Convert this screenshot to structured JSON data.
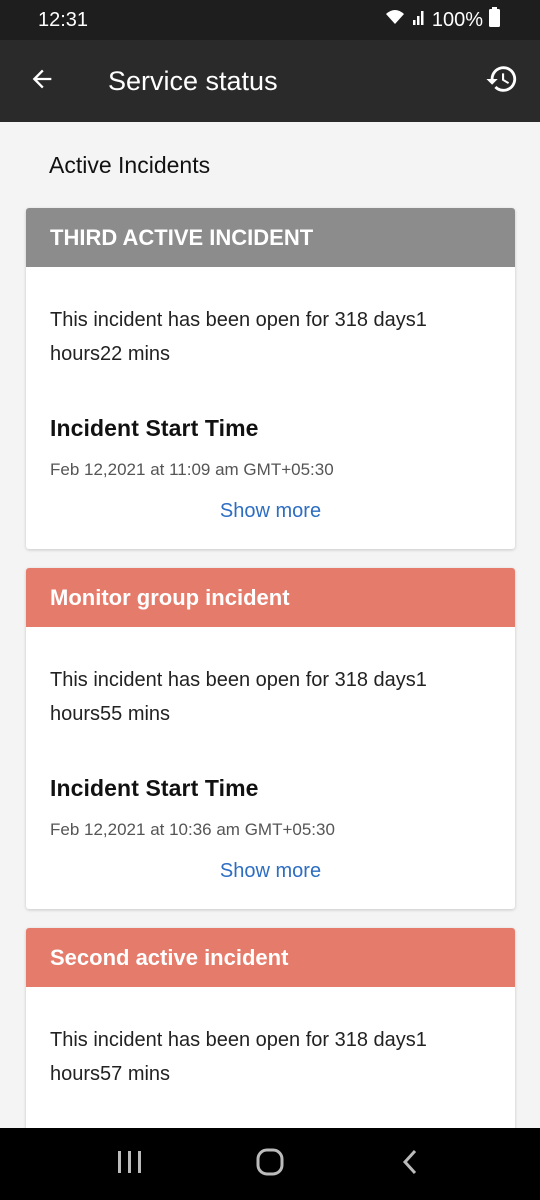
{
  "status_bar": {
    "time": "12:31",
    "battery": "100%"
  },
  "app_bar": {
    "title": "Service status"
  },
  "section": {
    "title": "Active Incidents"
  },
  "incidents": [
    {
      "title": "THIRD ACTIVE INCIDENT",
      "header_color": "#8c8c8c",
      "open_text": "This incident has been open for 318 days1 hours22 mins",
      "start_label": "Incident Start Time",
      "start_time": "Feb 12,2021 at 11:09 am GMT+05:30",
      "show_more": "Show more"
    },
    {
      "title": "Monitor group incident",
      "header_color": "#e57b6b",
      "open_text": "This incident has been open for 318 days1 hours55 mins",
      "start_label": "Incident Start Time",
      "start_time": "Feb 12,2021 at 10:36 am GMT+05:30",
      "show_more": "Show more"
    },
    {
      "title": "Second active incident",
      "header_color": "#e57b6b",
      "open_text": "This incident has been open for 318 days1 hours57 mins"
    }
  ],
  "colors": {
    "accent_link": "#2d6dc2",
    "app_bar_bg": "#2a2a2a"
  }
}
